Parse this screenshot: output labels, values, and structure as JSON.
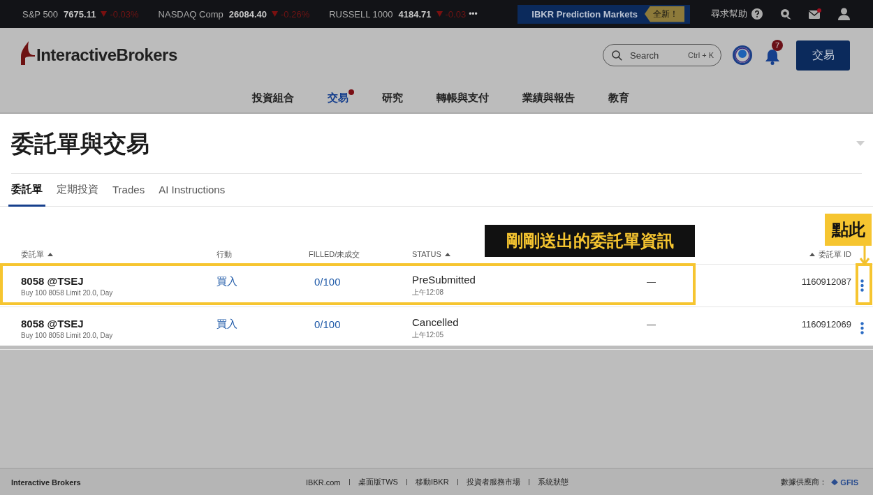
{
  "ticker": [
    {
      "name": "S&P 500",
      "value": "7675.11",
      "change": "-0.03%"
    },
    {
      "name": "NASDAQ Comp",
      "value": "26084.40",
      "change": "-0.26%"
    },
    {
      "name": "RUSSELL 1000",
      "value": "4184.71",
      "change": "-0.03"
    }
  ],
  "ticker_more": "•••",
  "promo": {
    "label": "IBKR Prediction Markets",
    "badge": "全新！"
  },
  "help": {
    "label": "尋求幫助"
  },
  "mail": {
    "unread": true
  },
  "header": {
    "logo": "InteractiveBrokers",
    "search_placeholder": "Search",
    "shortcut": "Ctrl + K",
    "notifications": "7",
    "trade_button": "交易"
  },
  "nav": [
    {
      "label": "投資組合",
      "selected": false,
      "dot": false
    },
    {
      "label": "交易",
      "selected": true,
      "dot": true
    },
    {
      "label": "研究",
      "selected": false,
      "dot": false
    },
    {
      "label": "轉帳與支付",
      "selected": false,
      "dot": false
    },
    {
      "label": "業績與報告",
      "selected": false,
      "dot": false
    },
    {
      "label": "教育",
      "selected": false,
      "dot": false
    }
  ],
  "page_title": "委託單與交易",
  "tabs": [
    {
      "label": "委託單",
      "selected": true
    },
    {
      "label": "定期投資",
      "selected": false
    },
    {
      "label": "Trades",
      "selected": false
    },
    {
      "label": "AI Instructions",
      "selected": false
    }
  ],
  "table": {
    "columns": [
      {
        "label": "委託單",
        "sorted": true
      },
      {
        "label": "行動",
        "sorted": false
      },
      {
        "label": "FILLED/未成交",
        "sorted": false
      },
      {
        "label": "STATUS",
        "sorted": true
      },
      {
        "label": "委託單 ID",
        "sorted": true
      }
    ],
    "rows": [
      {
        "symbol": "8058 @TSEJ",
        "description": "Buy 100 8058 Limit 20.0, Day",
        "action": "買入",
        "filled": "0/100",
        "status": "PreSubmitted",
        "time": "上午12:08",
        "column_5": "—",
        "order_id": "1160912087",
        "highlighted": true
      },
      {
        "symbol": "8058 @TSEJ",
        "description": "Buy 100 8058 Limit 20.0, Day",
        "action": "買入",
        "filled": "0/100",
        "status": "Cancelled",
        "time": "上午12:05",
        "column_5": "—",
        "order_id": "1160912069",
        "highlighted": false
      }
    ]
  },
  "annotations": [
    {
      "kind": "label",
      "text": "剛剛送出的委託單資訊"
    },
    {
      "kind": "pointer",
      "text": "點此"
    }
  ],
  "footer": {
    "brand": "Interactive Brokers",
    "links": [
      "IBKR.com",
      "桌面版TWS",
      "移動IBKR",
      "投資者服務市場",
      "系統狀態"
    ],
    "provider_label": "數據供應商：",
    "provider": "GFIS"
  }
}
